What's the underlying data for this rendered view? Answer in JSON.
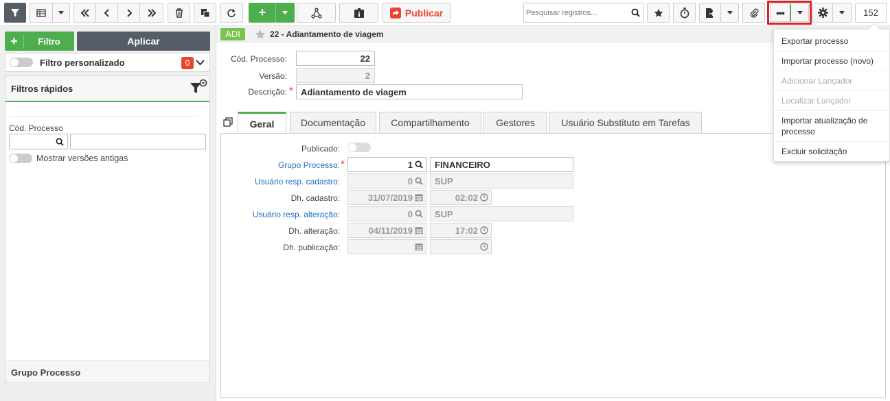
{
  "toolbar": {
    "search_placeholder": "Pesquisar registros...",
    "publish_label": "Publicar",
    "record_count": "152"
  },
  "sidebar": {
    "filter_button": "Filtro",
    "apply_button": "Aplicar",
    "custom_filter_label": "Filtro personalizado",
    "custom_filter_count": "0",
    "quick_filters_title": "Filtros rápidos",
    "cod_processo_label": "Cód. Processo",
    "old_versions_label": "Mostrar versões antigas",
    "group_section_title": "Grupo Processo"
  },
  "header": {
    "badge": "ADI",
    "title": "22 - Adiantamento de viagem"
  },
  "form": {
    "cod_processo_label": "Cód. Processo:",
    "cod_processo_value": "22",
    "versao_label": "Versão:",
    "versao_value": "2",
    "descricao_label": "Descrição:",
    "descricao_value": "Adiantamento de viagem"
  },
  "tabs": [
    "Geral",
    "Documentação",
    "Compartilhamento",
    "Gestores",
    "Usuário Substituto em Tarefas"
  ],
  "geral": {
    "publicado_label": "Publicado:",
    "grupo_label": "Grupo Processo:",
    "grupo_code": "1",
    "grupo_name": "FINANCEIRO",
    "user_cad_label": "Usuário resp. cadastro:",
    "user_cad_code": "0",
    "user_cad_name": "SUP",
    "dh_cad_label": "Dh. cadastro:",
    "dh_cad_date": "31/07/2019",
    "dh_cad_time": "02:02",
    "user_alt_label": "Usuário resp. alteração:",
    "user_alt_code": "0",
    "user_alt_name": "SUP",
    "dh_alt_label": "Dh. alteração:",
    "dh_alt_date": "04/11/2019",
    "dh_alt_time": "17:02",
    "dh_pub_label": "Dh. publicação:"
  },
  "menu": {
    "items": [
      {
        "label": "Exportar processo",
        "enabled": true
      },
      {
        "label": "Importar processo (novo)",
        "enabled": true
      },
      {
        "label": "Adicionar Lançador",
        "enabled": false
      },
      {
        "label": "Localizar Lançador",
        "enabled": false
      },
      {
        "label": "Importar atualização de processo",
        "enabled": true
      },
      {
        "label": "Excluir solicitação",
        "enabled": true
      }
    ]
  },
  "colors": {
    "accent_green": "#4cae4c",
    "publish_red": "#e8442e",
    "highlight_red": "#d9232a",
    "dark_button": "#555e66"
  }
}
